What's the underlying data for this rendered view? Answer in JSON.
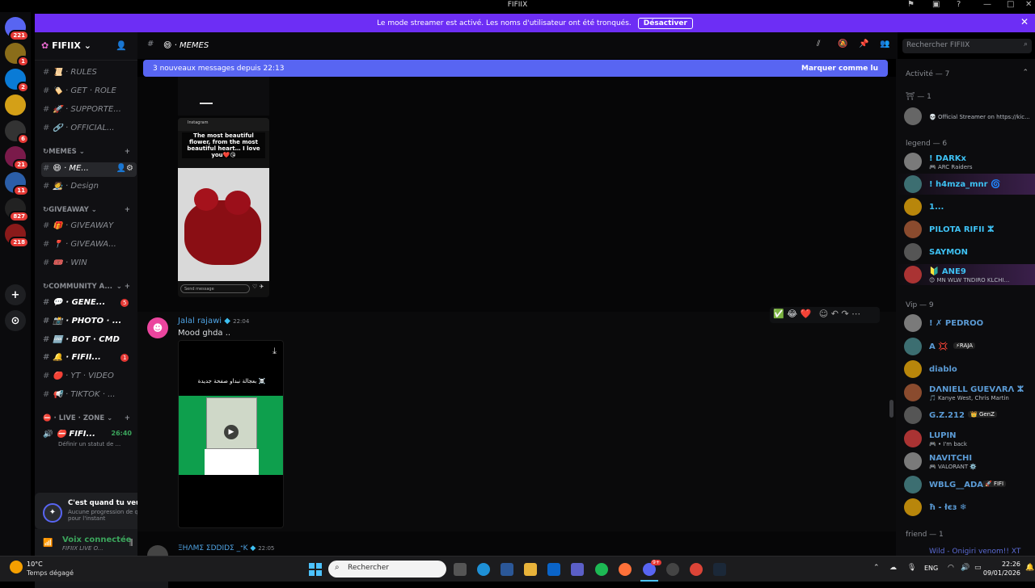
{
  "window": {
    "title": "FIFIIX"
  },
  "servers": [
    {
      "badge": "221",
      "color": "#5865f2"
    },
    {
      "badge": "1",
      "color": "#8a6d1a"
    },
    {
      "badge": "2",
      "color": "#0a7bd6"
    },
    {
      "badge": "",
      "color": "#d4a017"
    },
    {
      "badge": "6",
      "color": "#333"
    },
    {
      "badge": "21",
      "color": "#7a1a4a"
    },
    {
      "badge": "11",
      "color": "#2b5ea8"
    },
    {
      "badge": "827",
      "color": "#222"
    },
    {
      "badge": "218",
      "color": "#8a1a1a"
    }
  ],
  "banner": {
    "text": "Le mode streamer est activé. Les noms d'utilisateur ont été tronqués.",
    "button": "Désactiver"
  },
  "sidebar": {
    "guild": "FIFIIX",
    "channels": [
      {
        "name": "📜 · RULES"
      },
      {
        "name": "🏷️ · GET · ROLE"
      },
      {
        "name": "🚀 · SUPPORTE..."
      },
      {
        "name": "🔗 · OFFICIAL..."
      }
    ],
    "cat_memes": "MEMES",
    "memes": [
      {
        "name": "😄 · ME..."
      },
      {
        "name": "🧑‍🎨 · Design"
      }
    ],
    "cat_giveaway": "GIVEAWAY",
    "giveaway": [
      {
        "name": "🎁 · GIVEAWAY"
      },
      {
        "name": "📍 · GIVEAWA..."
      },
      {
        "name": "🎟️ · WIN"
      }
    ],
    "cat_community": "COMMUNITY A...",
    "community": [
      {
        "name": "💬 · GENE...",
        "badge": "5"
      },
      {
        "name": "📸 · PHOTO · ..."
      },
      {
        "name": "🆒 · BOT · CMD"
      },
      {
        "name": "🔔 · FIFII...",
        "badge": "1"
      },
      {
        "name": "🔴 · YT · VIDEO"
      },
      {
        "name": "📢 · TIKTOK · ..."
      }
    ],
    "cat_live": "⛔ · LIVE · ZONE",
    "live_channel": "FIFI...",
    "live_time": "26:40",
    "live_status": "Définir un statut de ..."
  },
  "quest": {
    "title": "C'est quand tu veux...",
    "subtitle": "Aucune progression de quête pour l'instant"
  },
  "voice": {
    "status": "Voix connectée",
    "channel": "FIFIIX LIVE O..."
  },
  "header": {
    "channel": "😄 · MEMES",
    "search_placeholder": "Rechercher FIFIIX"
  },
  "newbar": {
    "text": "3 nouveaux messages depuis 22:13",
    "mark": "Marquer comme lu"
  },
  "post": {
    "story_header": "Instagram",
    "story_caption": "The most beautiful flower, from the most beautiful heart… I love you❤️😘",
    "story_input": "Send message"
  },
  "message": {
    "author": "Jalal rajawi",
    "time": "22:04",
    "text": "Mood ghda ..",
    "video_caption": "بعجالة نبداو صفحة جديدة ☠️",
    "reactions": [
      "✅",
      "😂",
      "❤️"
    ]
  },
  "next_message": {
    "author": "ΞНΛMΣ ΣDDIDΣ _ᐩK",
    "time": "22:05"
  },
  "members": {
    "activity": "Activité — 7",
    "sec1": "⛩ — 1",
    "streamer": "💀 Official Streamer on https://kic...",
    "legend": "legend — 6",
    "legends": [
      {
        "name": "! DARKx",
        "sub": "🎮 ARC Raiders",
        "color": "#3ec1f3"
      },
      {
        "name": "! h4mza_mnr 🌀",
        "sub": "",
        "color": "#3ec1f3"
      },
      {
        "name": "1...",
        "sub": "",
        "color": "#3ec1f3"
      },
      {
        "name": "PILOTA RIFII ⵣ",
        "sub": "",
        "color": "#3ec1f3"
      },
      {
        "name": "SAYMON",
        "sub": "",
        "color": "#3ec1f3"
      },
      {
        "name": "🔰 ANE9",
        "sub": "😊 MN WLW TNDIRO KLCHI...",
        "color": "#3ec1f3"
      }
    ],
    "vip": "Vip — 9",
    "vips": [
      {
        "name": "! ✗ PEDROO",
        "sub": "",
        "color": "#5b9bd5"
      },
      {
        "name": "A 💢",
        "tag": "⚡RAJA",
        "sub": "",
        "color": "#5b9bd5"
      },
      {
        "name": "diablo",
        "sub": "",
        "color": "#5b9bd5"
      },
      {
        "name": "DΛNIELL GUEVΛRΛ ⵣ",
        "sub": "🎵 Kanye West, Chris Martin",
        "color": "#5b9bd5"
      },
      {
        "name": "G.Z.212",
        "tag": "👑 GenZ",
        "sub": "",
        "color": "#5b9bd5"
      },
      {
        "name": "LUPIN",
        "sub": "🎮 • I'm back",
        "color": "#5b9bd5"
      },
      {
        "name": "NAVITCHI",
        "sub": "🎮 VALORANT ⚙️",
        "color": "#5b9bd5"
      },
      {
        "name": "WBLG__ADAM",
        "tag": "🚀 FIFI",
        "sub": "",
        "color": "#5b9bd5"
      },
      {
        "name": "ħ - łєз ❄",
        "sub": "",
        "color": "#5b9bd5"
      }
    ],
    "friend": "friend — 1",
    "friend_name": "Wild - Onigiri venom!! XT"
  },
  "taskbar": {
    "weather_temp": "10°C",
    "weather_desc": "Temps dégagé",
    "search": "Rechercher",
    "lang": "ENG",
    "time": "22:26",
    "date": "09/01/2026",
    "discord_badge": "9+"
  }
}
